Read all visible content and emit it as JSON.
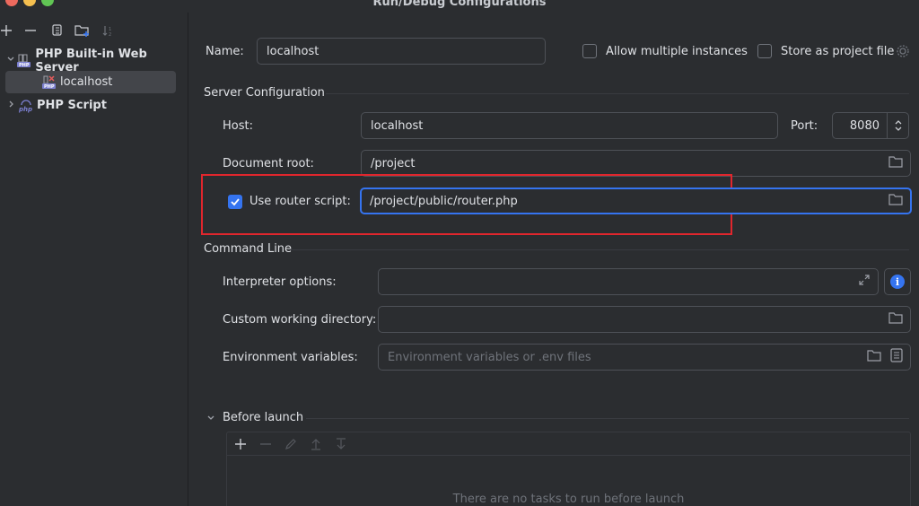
{
  "window": {
    "title": "Run/Debug Configurations"
  },
  "sidebar": {
    "tree": [
      {
        "label": "PHP Built-in Web Server",
        "expanded": true
      },
      {
        "label": "localhost",
        "selected": true
      },
      {
        "label": "PHP Script",
        "expanded": false
      }
    ]
  },
  "config": {
    "name_label": "Name:",
    "name_value": "localhost",
    "allow_multiple_label": "Allow multiple instances",
    "allow_multiple_checked": false,
    "store_project_label": "Store as project file",
    "store_project_checked": false
  },
  "server": {
    "section_title": "Server Configuration",
    "host_label": "Host:",
    "host_value": "localhost",
    "port_label": "Port:",
    "port_value": "8080",
    "docroot_label": "Document root:",
    "docroot_value": "/project",
    "router_label": "Use router script:",
    "router_checked": true,
    "router_value": "/project/public/router.php"
  },
  "command_line": {
    "section_title": "Command Line",
    "interpreter_label": "Interpreter options:",
    "interpreter_value": "",
    "workdir_label": "Custom working directory:",
    "workdir_value": "",
    "env_label": "Environment variables:",
    "env_placeholder": "Environment variables or .env files"
  },
  "before_launch": {
    "section_title": "Before launch",
    "empty_text": "There are no tasks to run before launch"
  },
  "colors": {
    "background": "#2b2d30",
    "accent": "#3574f0",
    "highlight_box": "#e0262d"
  }
}
